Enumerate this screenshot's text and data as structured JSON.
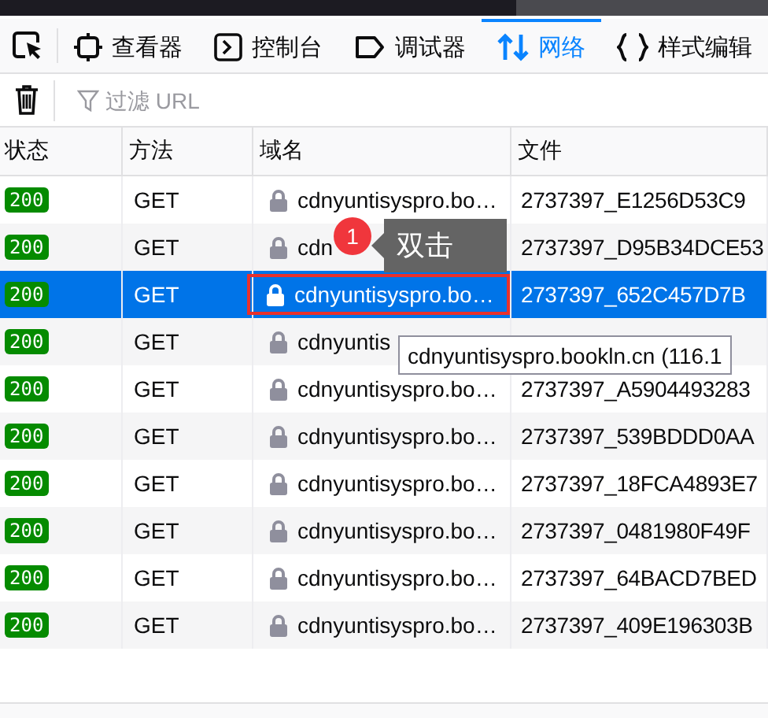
{
  "tabs": [
    {
      "label": "查看器",
      "selected": false
    },
    {
      "label": "控制台",
      "selected": false
    },
    {
      "label": "调试器",
      "selected": false
    },
    {
      "label": "网络",
      "selected": true
    },
    {
      "label": "样式编辑",
      "selected": false
    }
  ],
  "filter": {
    "placeholder": "过滤 URL"
  },
  "table": {
    "columns": [
      "状态",
      "方法",
      "域名",
      "文件"
    ],
    "rows": [
      {
        "status": "200",
        "method": "GET",
        "domain": "cdnyuntisyspro.bo…",
        "file": "2737397_E1256D53C9",
        "selected": false
      },
      {
        "status": "200",
        "method": "GET",
        "domain": "cdn",
        "file": "2737397_D95B34DCE53",
        "selected": false
      },
      {
        "status": "200",
        "method": "GET",
        "domain": "cdnyuntisyspro.bo…",
        "file": "2737397_652C457D7B",
        "selected": true,
        "highlighted": true
      },
      {
        "status": "200",
        "method": "GET",
        "domain": "cdnyuntis",
        "selected": false
      },
      {
        "status": "200",
        "method": "GET",
        "domain": "cdnyuntisyspro.bo…",
        "file": "2737397_A5904493283",
        "selected": false
      },
      {
        "status": "200",
        "method": "GET",
        "domain": "cdnyuntisyspro.bo…",
        "file": "2737397_539BDDD0AA",
        "selected": false
      },
      {
        "status": "200",
        "method": "GET",
        "domain": "cdnyuntisyspro.bo…",
        "file": "2737397_18FCA4893E7",
        "selected": false
      },
      {
        "status": "200",
        "method": "GET",
        "domain": "cdnyuntisyspro.bo…",
        "file": "2737397_0481980F49F",
        "selected": false
      },
      {
        "status": "200",
        "method": "GET",
        "domain": "cdnyuntisyspro.bo…",
        "file": "2737397_64BACD7BED",
        "selected": false
      },
      {
        "status": "200",
        "method": "GET",
        "domain": "cdnyuntisyspro.bo…",
        "file": "2737397_409E196303B",
        "selected": false
      }
    ]
  },
  "tooltip": {
    "text": "cdnyuntisyspro.bookln.cn (116.1"
  },
  "callout": {
    "number": "1",
    "text": "双击"
  }
}
